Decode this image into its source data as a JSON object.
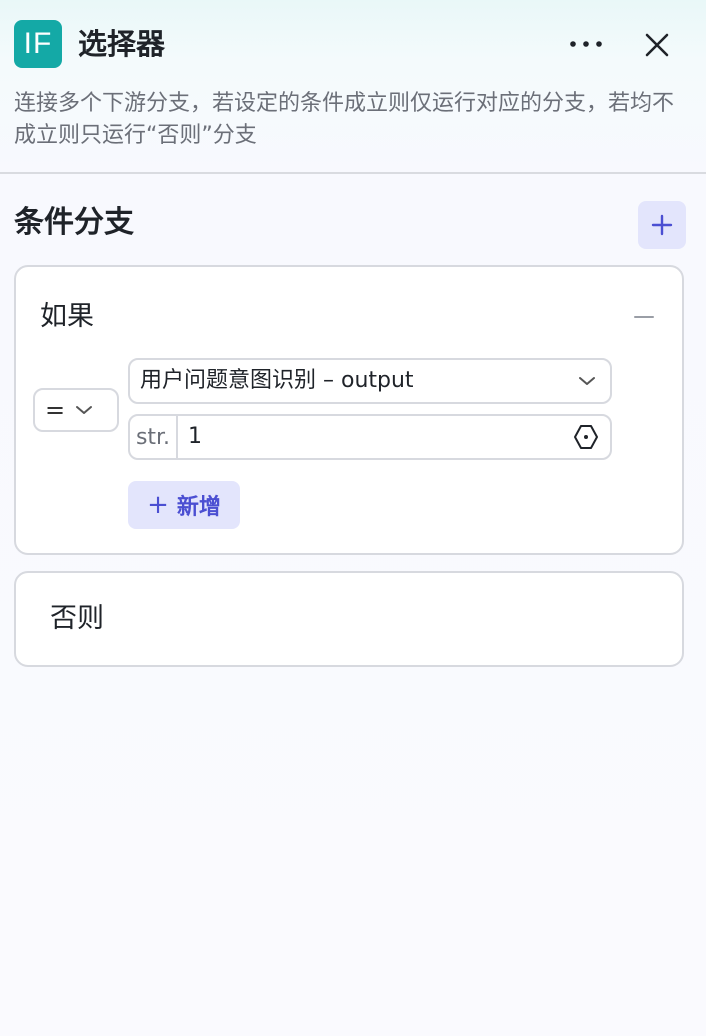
{
  "header": {
    "logo_text": "IF",
    "title": "选择器",
    "more_icon": "more-icon",
    "close_icon": "close-icon"
  },
  "description": "连接多个下游分支，若设定的条件成立则仅运行对应的分支，若均不成立则只运行“否则”分支",
  "section": {
    "title": "条件分支",
    "add_icon": "plus-icon"
  },
  "if_branch": {
    "label": "如果",
    "collapse_icon": "minus-icon",
    "operator": "=",
    "variable": "用户问题意图识别 – output",
    "value_type": "str.",
    "value": "1",
    "add_label": "新增",
    "add_symbol": "+"
  },
  "else_branch": {
    "label": "否则"
  },
  "colors": {
    "brand": "#14a9a6",
    "accent": "#4b4fd2",
    "accent_bg": "#e3e5fc"
  }
}
